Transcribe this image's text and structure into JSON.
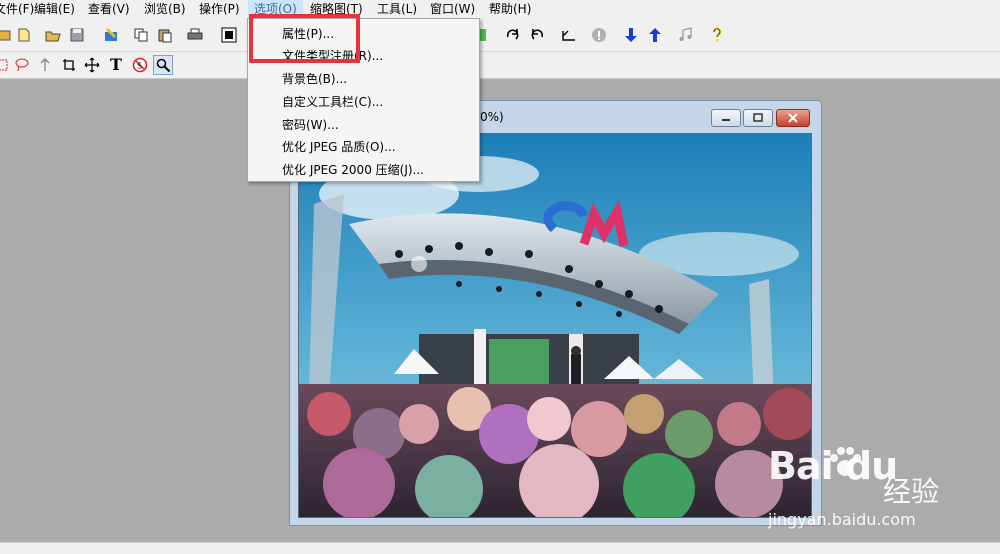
{
  "menubar": {
    "items": [
      {
        "label": "文件(F)"
      },
      {
        "label": "编辑(E)"
      },
      {
        "label": "查看(V)"
      },
      {
        "label": "浏览(B)"
      },
      {
        "label": "操作(P)"
      },
      {
        "label": "选项(O)"
      },
      {
        "label": "缩略图(T)"
      },
      {
        "label": "工具(L)"
      },
      {
        "label": "窗口(W)"
      },
      {
        "label": "帮助(H)"
      }
    ]
  },
  "options_menu": {
    "items": [
      {
        "label": "属性(P)..."
      },
      {
        "label": "文件类型注册(R)..."
      },
      {
        "label": "背景色(B)..."
      },
      {
        "label": "自定义工具栏(C)..."
      },
      {
        "label": "密码(W)..."
      },
      {
        "label": "优化 JPEG 品质(O)..."
      },
      {
        "label": "优化 JPEG 2000 压缩(J)..."
      }
    ]
  },
  "image_window": {
    "title": "0%)"
  },
  "toolbar2": {
    "text_tool": "T"
  },
  "watermark": {
    "brand": "Bai du",
    "subtitle": "经验",
    "url": "jingyan.baidu.com"
  },
  "colors": {
    "highlight": "#e8333f",
    "arrow_blue": "#1a3fd1",
    "help_yellow": "#f2d21b"
  }
}
